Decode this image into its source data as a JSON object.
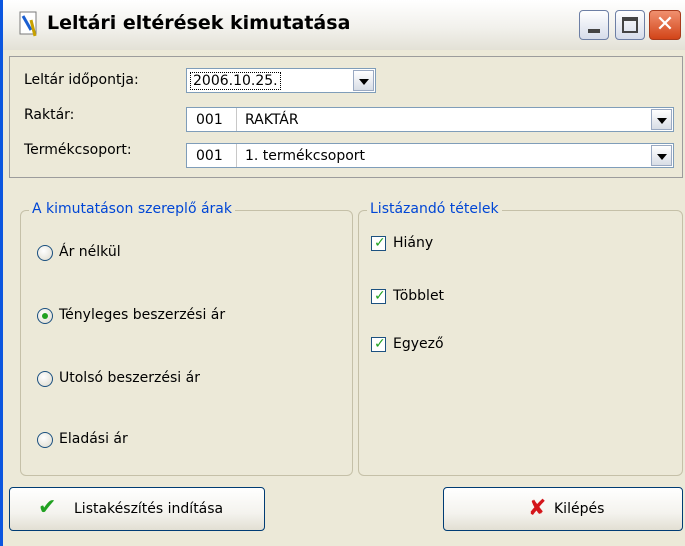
{
  "window": {
    "title": "Leltári eltérések kimutatása",
    "controls": {
      "minimize": "minimize-icon",
      "maximize": "maximize-icon",
      "close": "close-icon"
    }
  },
  "form": {
    "date_label": "Leltár időpontja:",
    "date_value": "2006.10.25.",
    "warehouse_label": "Raktár:",
    "warehouse_code": "001",
    "warehouse_name": "RAKTÁR",
    "group_label": "Termékcsoport:",
    "group_code": "001",
    "group_name": "1. termékcsoport"
  },
  "prices": {
    "title": "A kimutatáson szereplő árak",
    "options": [
      {
        "label": "Ár nélkül",
        "selected": false
      },
      {
        "label": "Tényleges beszerzési ár",
        "selected": true
      },
      {
        "label": "Utolsó beszerzési ár",
        "selected": false
      },
      {
        "label": "Eladási ár",
        "selected": false
      }
    ]
  },
  "items": {
    "title": "Listázandó tételek",
    "checks": [
      {
        "label": "Hiány",
        "checked": true
      },
      {
        "label": "Többlet",
        "checked": true
      },
      {
        "label": "Egyező",
        "checked": true
      }
    ]
  },
  "buttons": {
    "start_label": "Listakészítés indítása",
    "exit_label": "Kilépés"
  },
  "colors": {
    "group_title": "#0046d5",
    "check_mark": "#21a121",
    "exit_icon": "#d4161b"
  }
}
